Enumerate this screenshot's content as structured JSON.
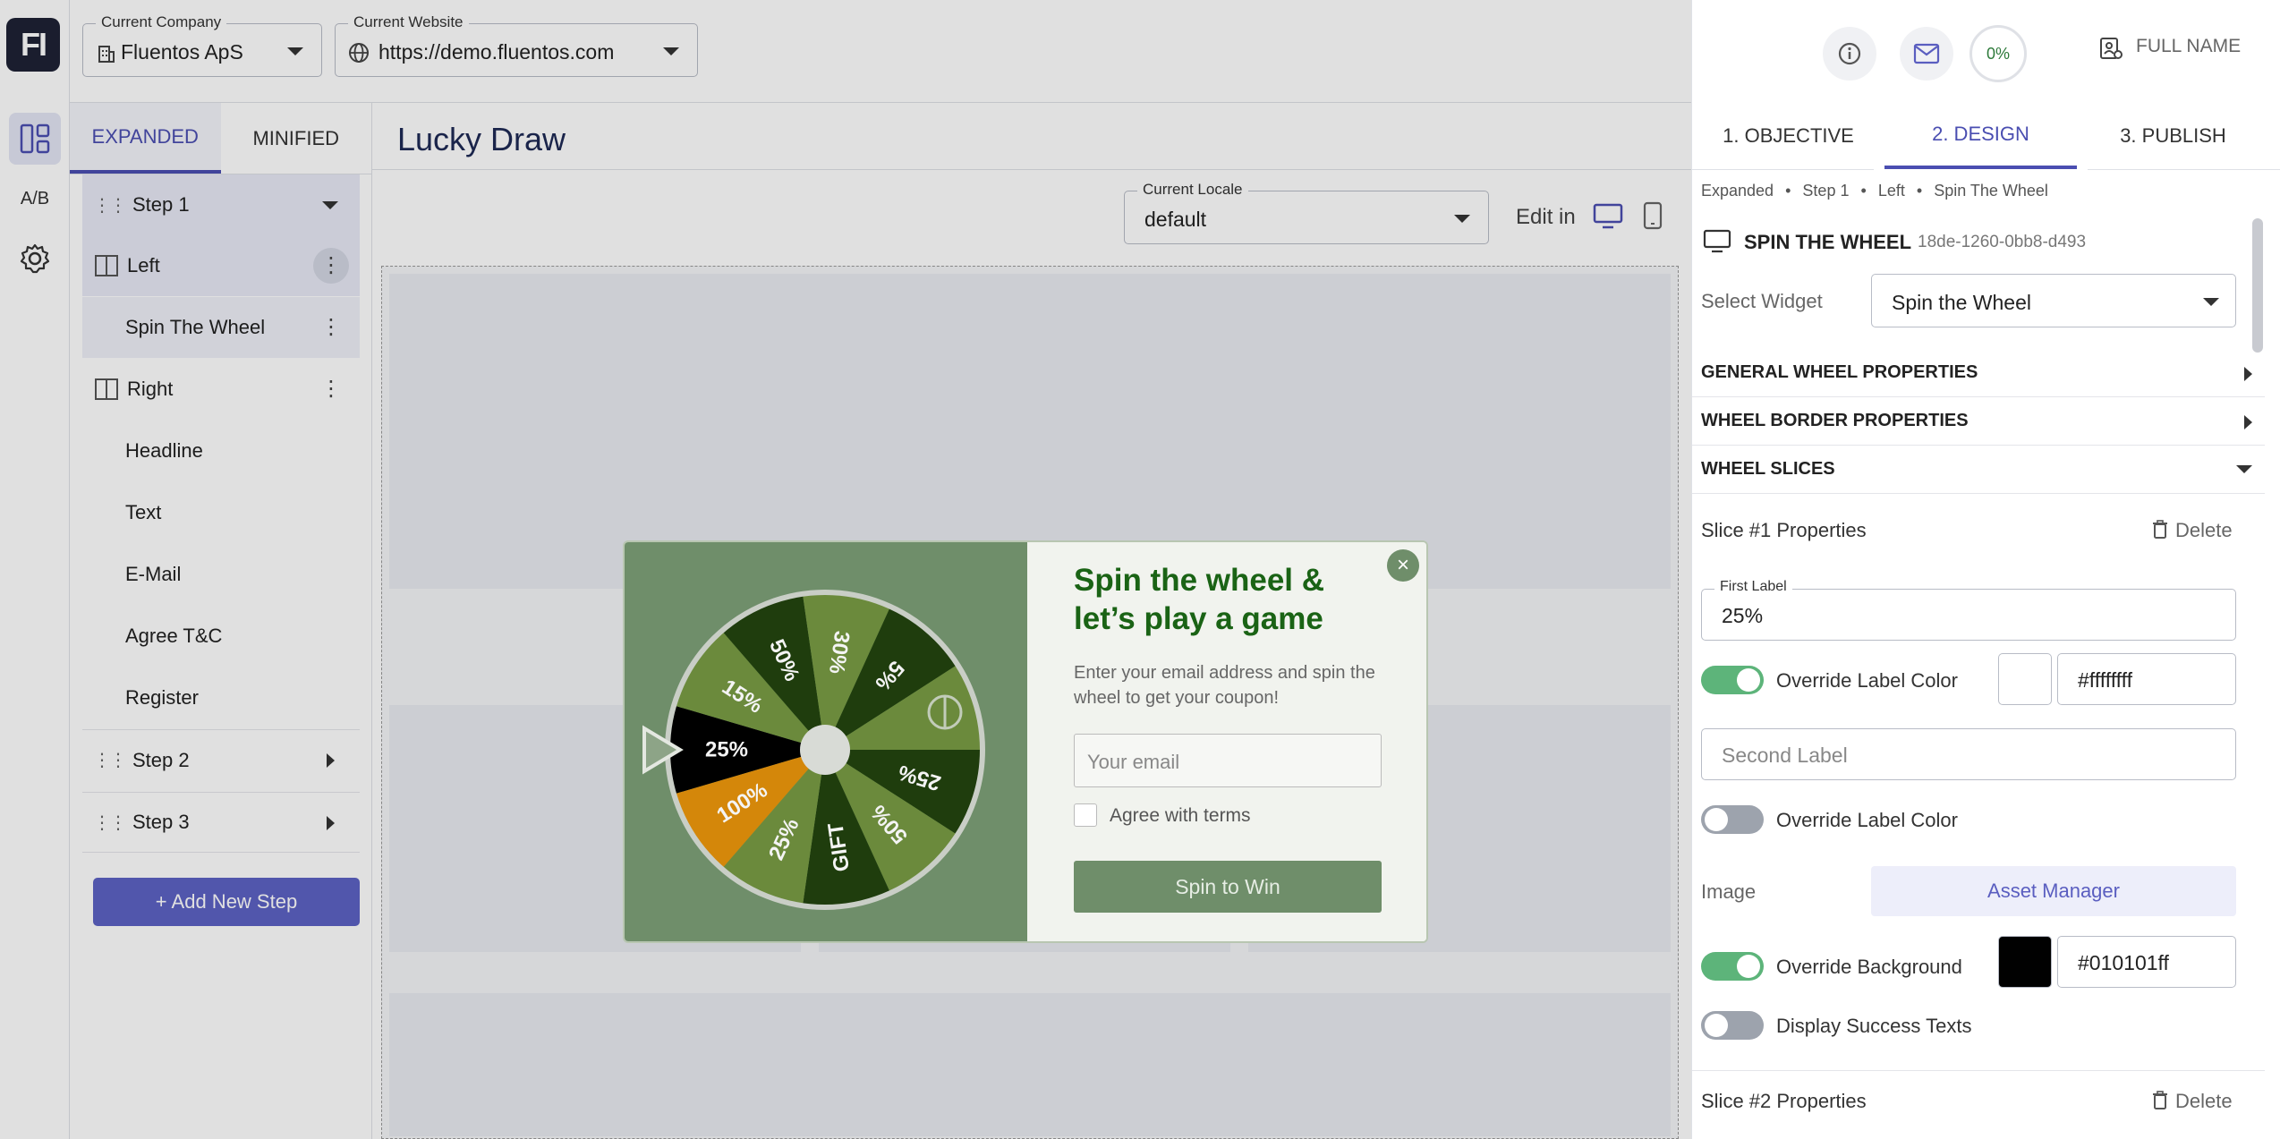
{
  "rail": {
    "logo": "FI",
    "ab_label": "A/B"
  },
  "topbar": {
    "company_label": "Current Company",
    "company_value": "Fluentos ApS",
    "website_label": "Current Website",
    "website_value": "https://demo.fluentos.com"
  },
  "tree": {
    "tabs": [
      "EXPANDED",
      "MINIFIED"
    ],
    "step1": "Step 1",
    "left": "Left",
    "spin": "Spin The Wheel",
    "right": "Right",
    "headline": "Headline",
    "text": "Text",
    "email": "E-Mail",
    "agree": "Agree T&C",
    "register": "Register",
    "step2": "Step 2",
    "step3": "Step 3",
    "add_step": "+ Add New Step"
  },
  "canvas": {
    "title": "Lucky Draw",
    "locale_label": "Current Locale",
    "locale_value": "default",
    "edit_in": "Edit in"
  },
  "popup": {
    "title": "Spin the wheel & let’s play a game",
    "desc": "Enter your email address and spin the wheel to get your coupon!",
    "email_placeholder": "Your email",
    "terms": "Agree with terms",
    "button": "Spin to Win",
    "slices": [
      "25%",
      "15%",
      "50%",
      "30%",
      "5%",
      "",
      "25%",
      "50%",
      "GIFT",
      "25%",
      "100%"
    ],
    "slice_colors": [
      "#000000",
      "#6b8a3c",
      "#1f3d0d",
      "#6b8a3c",
      "#1f3d0d",
      "#6b8a3c",
      "#1f3d0d",
      "#6b8a3c",
      "#1f3d0d",
      "#6b8a3c",
      "#d4870a"
    ]
  },
  "rpanel": {
    "progress": "0%",
    "full_name": "FULL NAME",
    "tabs": [
      "1. OBJECTIVE",
      "2. DESIGN",
      "3. PUBLISH"
    ],
    "crumbs": [
      "Expanded",
      "Step 1",
      "Left",
      "Spin The Wheel"
    ],
    "widget_title": "SPIN THE WHEEL",
    "widget_id": "18de-1260-0bb8-d493",
    "select_widget_label": "Select Widget",
    "select_widget_value": "Spin the Wheel",
    "general": "GENERAL WHEEL PROPERTIES",
    "border": "WHEEL BORDER PROPERTIES",
    "slices": "WHEEL SLICES",
    "slice1": "Slice #1 Properties",
    "delete": "Delete",
    "first_label_label": "First Label",
    "first_label_value": "25%",
    "override_label_color": "Override Label Color",
    "label_color_hex": "#ffffffff",
    "second_label_placeholder": "Second Label",
    "image_label": "Image",
    "asset_manager": "Asset Manager",
    "override_background": "Override Background",
    "bg_color_hex": "#010101ff",
    "display_success": "Display Success Texts",
    "slice2": "Slice #2 Properties"
  }
}
